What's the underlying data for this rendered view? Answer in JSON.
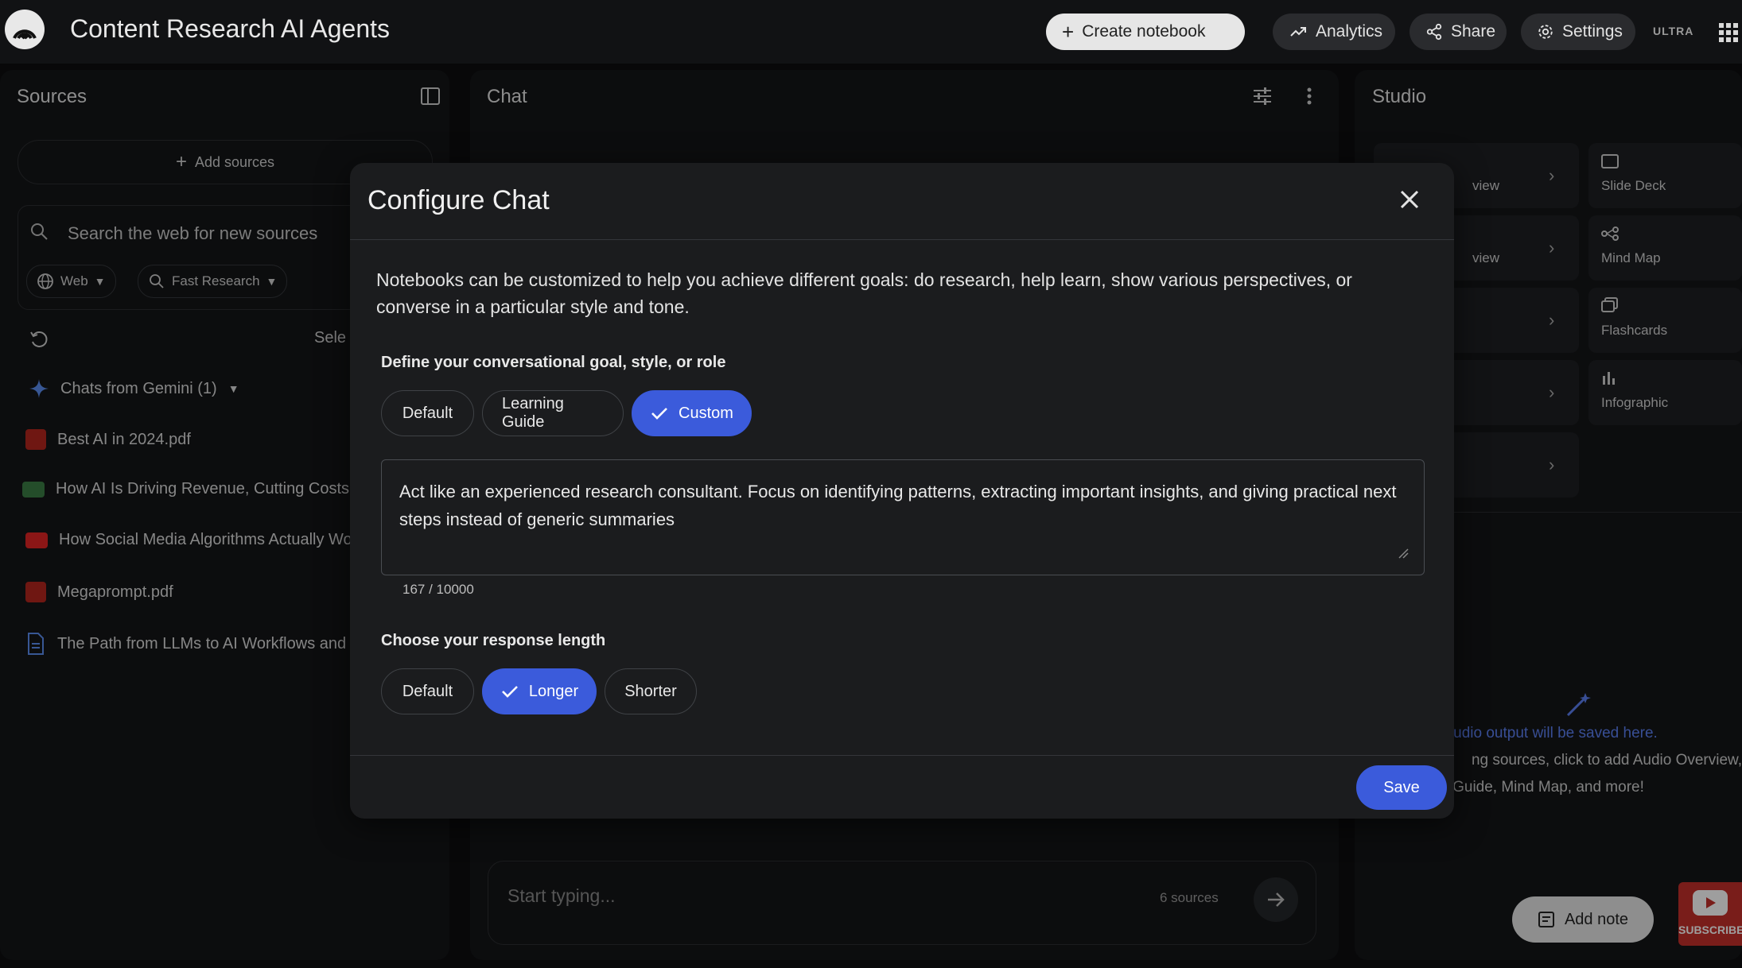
{
  "app": {
    "title": "Content Research AI Agents",
    "tier_badge": "ULTRA"
  },
  "header": {
    "create_notebook": "Create notebook",
    "analytics": "Analytics",
    "share": "Share",
    "settings": "Settings"
  },
  "sources": {
    "title": "Sources",
    "add_sources": "Add sources",
    "search_placeholder": "Search the web for new sources",
    "web_filter": "Web",
    "research_mode": "Fast Research",
    "select_label": "Sele",
    "items": [
      {
        "label": "Chats from Gemini (1)",
        "type": "gemini"
      },
      {
        "label": "Best AI in 2024.pdf",
        "type": "pdf"
      },
      {
        "label": "How AI Is Driving Revenue, Cutting Costs",
        "type": "web"
      },
      {
        "label": "How Social Media Algorithms Actually Wo",
        "type": "youtube"
      },
      {
        "label": "Megaprompt.pdf",
        "type": "pdf"
      },
      {
        "label": "The Path from LLMs to AI Workflows and",
        "type": "doc"
      }
    ]
  },
  "chat": {
    "title": "Chat",
    "input_placeholder": "Start typing...",
    "source_count": "6 sources"
  },
  "studio": {
    "title": "Studio",
    "cards": [
      {
        "label": "Slide Deck",
        "icon": "slides-icon"
      },
      {
        "label": "Mind Map",
        "icon": "mindmap-icon"
      },
      {
        "label": "Flashcards",
        "icon": "flashcards-icon"
      },
      {
        "label": "Infographic",
        "icon": "infographic-icon"
      }
    ],
    "left_card_fragments": [
      "view",
      "view"
    ],
    "output_line1": "Studio output will be saved here.",
    "output_line2": "ng sources, click to add Audio Overview,",
    "output_line3": "Guide, Mind Map, and more!",
    "add_note": "Add note"
  },
  "subscribe_badge": "SUBSCRIBE",
  "modal": {
    "title": "Configure Chat",
    "description": "Notebooks can be customized to help you achieve different goals: do research, help learn, show various perspectives, or converse in a particular style and tone.",
    "goal_label": "Define your conversational goal, style, or role",
    "goal_options": [
      "Default",
      "Learning Guide",
      "Custom"
    ],
    "goal_selected": "Custom",
    "custom_prompt": "Act like an experienced research consultant. Focus on identifying patterns, extracting important insights, and giving practical next steps instead of generic summaries",
    "char_count": "167 / 10000",
    "length_label": "Choose your response length",
    "length_options": [
      "Default",
      "Longer",
      "Shorter"
    ],
    "length_selected": "Longer",
    "save": "Save"
  },
  "colors": {
    "accent": "#3b5bdb",
    "background": "#0d0e10",
    "panel": "#141517",
    "modal": "#1b1c1e"
  }
}
